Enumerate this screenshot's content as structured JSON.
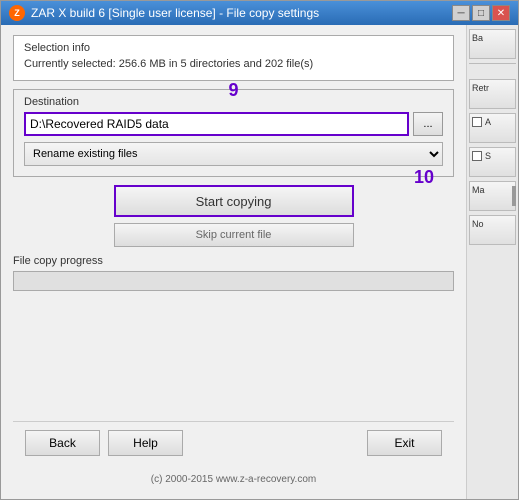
{
  "window": {
    "title": "ZAR X build 6 [Single user license] - File copy settings",
    "icon": "Z"
  },
  "controls": {
    "minimize": "─",
    "maximize": "□",
    "close": "✕"
  },
  "selection_info": {
    "group_label": "Selection info",
    "info_text": "Currently selected: 256.6 MB in 5 directories and 202 file(s)"
  },
  "destination": {
    "group_label": "Destination",
    "step_number": "9",
    "input_value": "D:\\Recovered RAID5 data",
    "browse_label": "...",
    "rename_option": "Rename existing files"
  },
  "actions": {
    "step_number": "10",
    "start_copy_label": "Start copying",
    "skip_label": "Skip current file"
  },
  "progress": {
    "label": "File copy progress"
  },
  "footer": {
    "back_label": "Back",
    "help_label": "Help",
    "exit_label": "Exit",
    "copyright": "(c) 2000-2015 www.z-a-recovery.com"
  },
  "sidebar": {
    "items": [
      {
        "label": "Ba"
      },
      {
        "label": "–"
      },
      {
        "label": "Retr"
      },
      {
        "label": "A"
      },
      {
        "label": "S"
      },
      {
        "label": "Ma"
      },
      {
        "label": "No"
      }
    ]
  }
}
